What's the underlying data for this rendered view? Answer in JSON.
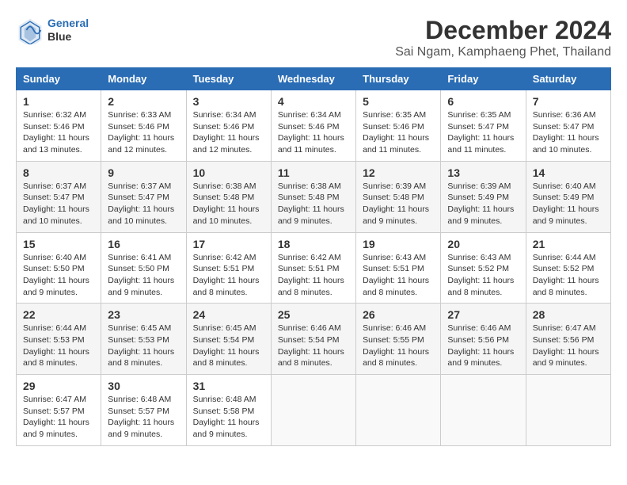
{
  "header": {
    "logo_line1": "General",
    "logo_line2": "Blue",
    "month": "December 2024",
    "location": "Sai Ngam, Kamphaeng Phet, Thailand"
  },
  "days_of_week": [
    "Sunday",
    "Monday",
    "Tuesday",
    "Wednesday",
    "Thursday",
    "Friday",
    "Saturday"
  ],
  "weeks": [
    [
      {
        "day": "1",
        "lines": [
          "Sunrise: 6:32 AM",
          "Sunset: 5:46 PM",
          "Daylight: 11 hours",
          "and 13 minutes."
        ]
      },
      {
        "day": "2",
        "lines": [
          "Sunrise: 6:33 AM",
          "Sunset: 5:46 PM",
          "Daylight: 11 hours",
          "and 12 minutes."
        ]
      },
      {
        "day": "3",
        "lines": [
          "Sunrise: 6:34 AM",
          "Sunset: 5:46 PM",
          "Daylight: 11 hours",
          "and 12 minutes."
        ]
      },
      {
        "day": "4",
        "lines": [
          "Sunrise: 6:34 AM",
          "Sunset: 5:46 PM",
          "Daylight: 11 hours",
          "and 11 minutes."
        ]
      },
      {
        "day": "5",
        "lines": [
          "Sunrise: 6:35 AM",
          "Sunset: 5:46 PM",
          "Daylight: 11 hours",
          "and 11 minutes."
        ]
      },
      {
        "day": "6",
        "lines": [
          "Sunrise: 6:35 AM",
          "Sunset: 5:47 PM",
          "Daylight: 11 hours",
          "and 11 minutes."
        ]
      },
      {
        "day": "7",
        "lines": [
          "Sunrise: 6:36 AM",
          "Sunset: 5:47 PM",
          "Daylight: 11 hours",
          "and 10 minutes."
        ]
      }
    ],
    [
      {
        "day": "8",
        "lines": [
          "Sunrise: 6:37 AM",
          "Sunset: 5:47 PM",
          "Daylight: 11 hours",
          "and 10 minutes."
        ]
      },
      {
        "day": "9",
        "lines": [
          "Sunrise: 6:37 AM",
          "Sunset: 5:47 PM",
          "Daylight: 11 hours",
          "and 10 minutes."
        ]
      },
      {
        "day": "10",
        "lines": [
          "Sunrise: 6:38 AM",
          "Sunset: 5:48 PM",
          "Daylight: 11 hours",
          "and 10 minutes."
        ]
      },
      {
        "day": "11",
        "lines": [
          "Sunrise: 6:38 AM",
          "Sunset: 5:48 PM",
          "Daylight: 11 hours",
          "and 9 minutes."
        ]
      },
      {
        "day": "12",
        "lines": [
          "Sunrise: 6:39 AM",
          "Sunset: 5:48 PM",
          "Daylight: 11 hours",
          "and 9 minutes."
        ]
      },
      {
        "day": "13",
        "lines": [
          "Sunrise: 6:39 AM",
          "Sunset: 5:49 PM",
          "Daylight: 11 hours",
          "and 9 minutes."
        ]
      },
      {
        "day": "14",
        "lines": [
          "Sunrise: 6:40 AM",
          "Sunset: 5:49 PM",
          "Daylight: 11 hours",
          "and 9 minutes."
        ]
      }
    ],
    [
      {
        "day": "15",
        "lines": [
          "Sunrise: 6:40 AM",
          "Sunset: 5:50 PM",
          "Daylight: 11 hours",
          "and 9 minutes."
        ]
      },
      {
        "day": "16",
        "lines": [
          "Sunrise: 6:41 AM",
          "Sunset: 5:50 PM",
          "Daylight: 11 hours",
          "and 9 minutes."
        ]
      },
      {
        "day": "17",
        "lines": [
          "Sunrise: 6:42 AM",
          "Sunset: 5:51 PM",
          "Daylight: 11 hours",
          "and 8 minutes."
        ]
      },
      {
        "day": "18",
        "lines": [
          "Sunrise: 6:42 AM",
          "Sunset: 5:51 PM",
          "Daylight: 11 hours",
          "and 8 minutes."
        ]
      },
      {
        "day": "19",
        "lines": [
          "Sunrise: 6:43 AM",
          "Sunset: 5:51 PM",
          "Daylight: 11 hours",
          "and 8 minutes."
        ]
      },
      {
        "day": "20",
        "lines": [
          "Sunrise: 6:43 AM",
          "Sunset: 5:52 PM",
          "Daylight: 11 hours",
          "and 8 minutes."
        ]
      },
      {
        "day": "21",
        "lines": [
          "Sunrise: 6:44 AM",
          "Sunset: 5:52 PM",
          "Daylight: 11 hours",
          "and 8 minutes."
        ]
      }
    ],
    [
      {
        "day": "22",
        "lines": [
          "Sunrise: 6:44 AM",
          "Sunset: 5:53 PM",
          "Daylight: 11 hours",
          "and 8 minutes."
        ]
      },
      {
        "day": "23",
        "lines": [
          "Sunrise: 6:45 AM",
          "Sunset: 5:53 PM",
          "Daylight: 11 hours",
          "and 8 minutes."
        ]
      },
      {
        "day": "24",
        "lines": [
          "Sunrise: 6:45 AM",
          "Sunset: 5:54 PM",
          "Daylight: 11 hours",
          "and 8 minutes."
        ]
      },
      {
        "day": "25",
        "lines": [
          "Sunrise: 6:46 AM",
          "Sunset: 5:54 PM",
          "Daylight: 11 hours",
          "and 8 minutes."
        ]
      },
      {
        "day": "26",
        "lines": [
          "Sunrise: 6:46 AM",
          "Sunset: 5:55 PM",
          "Daylight: 11 hours",
          "and 8 minutes."
        ]
      },
      {
        "day": "27",
        "lines": [
          "Sunrise: 6:46 AM",
          "Sunset: 5:56 PM",
          "Daylight: 11 hours",
          "and 9 minutes."
        ]
      },
      {
        "day": "28",
        "lines": [
          "Sunrise: 6:47 AM",
          "Sunset: 5:56 PM",
          "Daylight: 11 hours",
          "and 9 minutes."
        ]
      }
    ],
    [
      {
        "day": "29",
        "lines": [
          "Sunrise: 6:47 AM",
          "Sunset: 5:57 PM",
          "Daylight: 11 hours",
          "and 9 minutes."
        ]
      },
      {
        "day": "30",
        "lines": [
          "Sunrise: 6:48 AM",
          "Sunset: 5:57 PM",
          "Daylight: 11 hours",
          "and 9 minutes."
        ]
      },
      {
        "day": "31",
        "lines": [
          "Sunrise: 6:48 AM",
          "Sunset: 5:58 PM",
          "Daylight: 11 hours",
          "and 9 minutes."
        ]
      },
      null,
      null,
      null,
      null
    ]
  ]
}
